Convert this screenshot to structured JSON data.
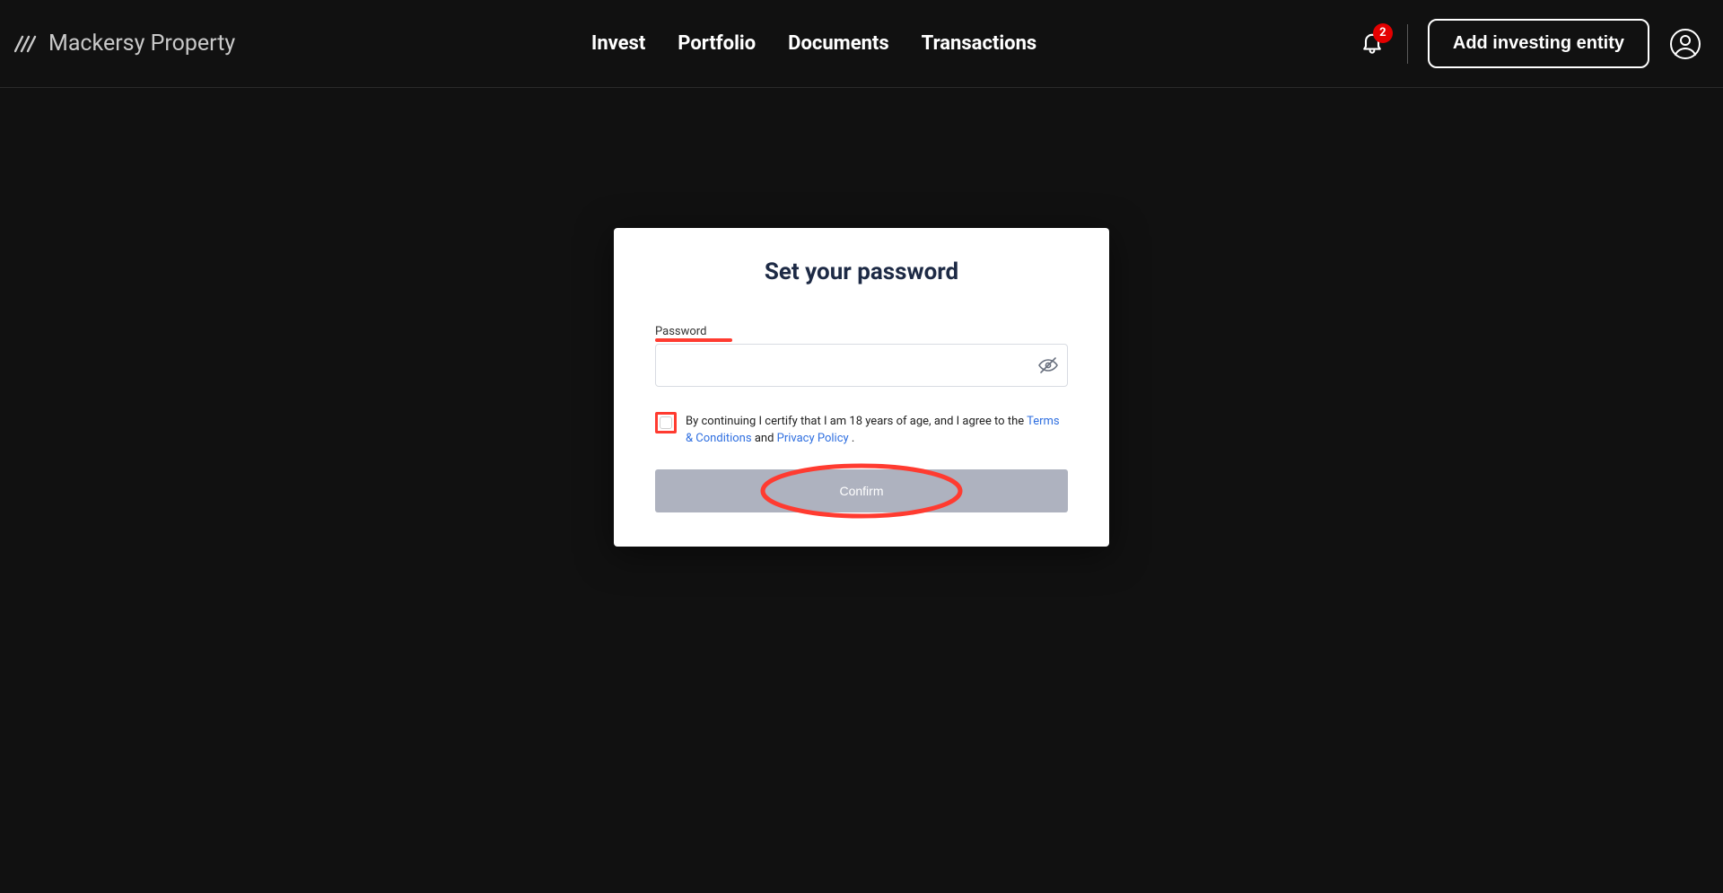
{
  "brand": {
    "name": "Mackersy Property"
  },
  "nav": {
    "items": [
      "Invest",
      "Portfolio",
      "Documents",
      "Transactions"
    ]
  },
  "header": {
    "notification_count": "2",
    "add_entity_label": "Add investing entity"
  },
  "modal": {
    "title": "Set your password",
    "password_label": "Password",
    "password_value": "",
    "consent_prefix": "By continuing I certify that I am 18 years of age, and I agree to the ",
    "terms_link": "Terms & Conditions",
    "consent_and": " and ",
    "privacy_link": "Privacy Policy",
    "consent_suffix": ".",
    "confirm_label": "Confirm"
  },
  "annotations": {
    "password_highlight_color": "#ff3b30",
    "checkbox_highlight_color": "#ff3b30",
    "confirm_circle_color": "#ff3b30"
  }
}
